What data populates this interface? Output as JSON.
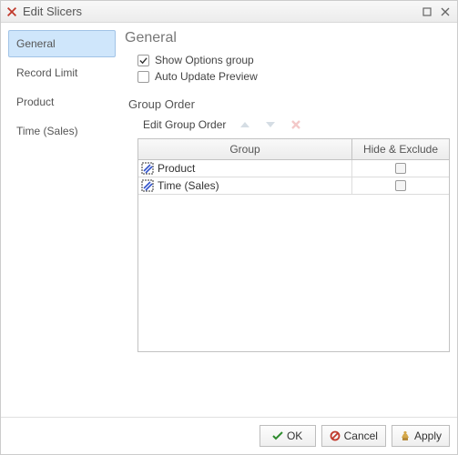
{
  "window": {
    "title": "Edit Slicers"
  },
  "sidebar": {
    "items": [
      {
        "label": "General",
        "active": true
      },
      {
        "label": "Record Limit",
        "active": false
      },
      {
        "label": "Product",
        "active": false
      },
      {
        "label": "Time (Sales)",
        "active": false
      }
    ]
  },
  "main": {
    "section_title": "General",
    "show_options": {
      "label": "Show Options group",
      "checked": true
    },
    "auto_update": {
      "label": "Auto Update Preview",
      "checked": false
    },
    "group_order": {
      "title": "Group Order",
      "edit_label": "Edit Group Order",
      "columns": {
        "group": "Group",
        "hide": "Hide & Exclude"
      },
      "rows": [
        {
          "label": "Product",
          "hide": false
        },
        {
          "label": "Time (Sales)",
          "hide": false
        }
      ]
    }
  },
  "footer": {
    "ok": "OK",
    "cancel": "Cancel",
    "apply": "Apply"
  }
}
